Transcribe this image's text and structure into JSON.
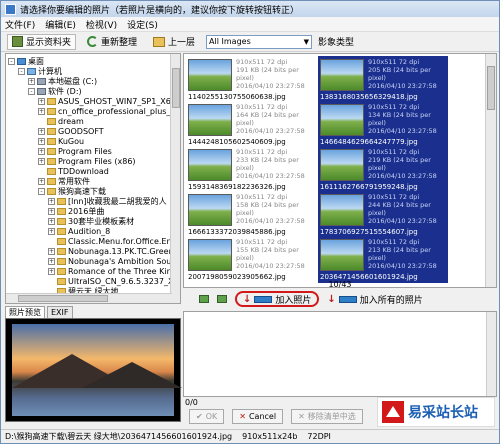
{
  "window": {
    "title": "请选择你要编辑的照片（若照片是横向的，建议你按下旋转按钮转正）"
  },
  "menu": [
    "文件(F)",
    "编辑(E)",
    "检视(V)",
    "设定(S)"
  ],
  "toolbar": {
    "show_folders": "显示资料夹",
    "reorganize": "重新整理",
    "up_one_level": "上一层",
    "filter_value": "All Images",
    "image_type": "影象类型"
  },
  "tree": [
    {
      "label": "桌面",
      "indent": 0,
      "icon": "desktop-icon",
      "expand": "-"
    },
    {
      "label": "计算机",
      "indent": 1,
      "icon": "computer-icon",
      "expand": "-"
    },
    {
      "label": "本地磁盘 (C:)",
      "indent": 2,
      "icon": "drive-icon",
      "expand": "+"
    },
    {
      "label": "软件 (D:)",
      "indent": 2,
      "icon": "drive-icon",
      "expand": "-"
    },
    {
      "label": "ASUS_GHOST_WIN7_SP1_X64_",
      "indent": 3,
      "icon": "folder-icon",
      "expand": "+"
    },
    {
      "label": "cn_office_professional_plus_2013",
      "indent": 3,
      "icon": "folder-icon",
      "expand": "+"
    },
    {
      "label": "dream",
      "indent": 3,
      "icon": "folder-icon",
      "expand": ""
    },
    {
      "label": "GOODSOFT",
      "indent": 3,
      "icon": "folder-icon",
      "expand": "+"
    },
    {
      "label": "KuGou",
      "indent": 3,
      "icon": "folder-icon",
      "expand": "+"
    },
    {
      "label": "Program Files",
      "indent": 3,
      "icon": "folder-icon",
      "expand": "+"
    },
    {
      "label": "Program Files (x86)",
      "indent": 3,
      "icon": "folder-icon",
      "expand": "+"
    },
    {
      "label": "TDDownload",
      "indent": 3,
      "icon": "folder-icon",
      "expand": ""
    },
    {
      "label": "常用软件",
      "indent": 3,
      "icon": "folder-icon",
      "expand": "+"
    },
    {
      "label": "猴狗高速下载",
      "indent": 3,
      "icon": "folder-icon",
      "expand": "-"
    },
    {
      "label": "[lnn]收藏我最二胡我爱的人",
      "indent": 4,
      "icon": "folder-icon",
      "expand": "+"
    },
    {
      "label": "2016单曲",
      "indent": 4,
      "icon": "folder-icon",
      "expand": "+"
    },
    {
      "label": "30套毕业模板素材",
      "indent": 4,
      "icon": "folder-icon",
      "expand": "+"
    },
    {
      "label": "Audition_8",
      "indent": 4,
      "icon": "folder-icon",
      "expand": "+"
    },
    {
      "label": "Classic.Menu.for.Office.Enterp",
      "indent": 4,
      "icon": "folder-icon",
      "expand": ""
    },
    {
      "label": "Nobunaga.13.PK.TC.Green.E",
      "indent": 4,
      "icon": "folder-icon",
      "expand": "+"
    },
    {
      "label": "Nobunaga's Ambition Souzou",
      "indent": 4,
      "icon": "folder-icon",
      "expand": "+"
    },
    {
      "label": "Romance of the Three Kingd",
      "indent": 4,
      "icon": "folder-icon",
      "expand": "+"
    },
    {
      "label": "UltraISO_CN_9.6.5.3237_X&",
      "indent": 4,
      "icon": "folder-icon",
      "expand": ""
    },
    {
      "label": "碧云天 绿大地",
      "indent": 4,
      "icon": "folder-icon",
      "expand": ""
    }
  ],
  "preview_tabs": [
    "照片预览",
    "EXIF"
  ],
  "thumbnails": [
    {
      "file": "1140255130755060638.jpg",
      "dims": "910x511 72 dpi",
      "size": "191 KB (24 bits per pixel)",
      "date": "2016/04/10 23:27:58",
      "selected": false
    },
    {
      "file": "1383168035656329418.jpg",
      "dims": "910x511 72 dpi",
      "size": "205 KB (24 bits per pixel)",
      "date": "2016/04/10 23:27:58",
      "selected": true
    },
    {
      "file": "1444248105602540609.jpg",
      "dims": "910x511 72 dpi",
      "size": "164 KB (24 bits per pixel)",
      "date": "2016/04/10 23:27:58",
      "selected": false
    },
    {
      "file": "1466484629664247779.jpg",
      "dims": "910x511 72 dpi",
      "size": "134 KB (24 bits per pixel)",
      "date": "2016/04/10 23:27:58",
      "selected": true
    },
    {
      "file": "1593148369182236326.jpg",
      "dims": "910x511 72 dpi",
      "size": "233 KB (24 bits per pixel)",
      "date": "2016/04/10 23:27:58",
      "selected": false
    },
    {
      "file": "1611162766791959248.jpg",
      "dims": "910x511 72 dpi",
      "size": "219 KB (24 bits per pixel)",
      "date": "2016/04/10 23:27:58",
      "selected": true
    },
    {
      "file": "1666133372039845886.jpg",
      "dims": "910x511 72 dpi",
      "size": "158 KB (24 bits per pixel)",
      "date": "2016/04/10 23:27:58",
      "selected": false
    },
    {
      "file": "1783706927515554607.jpg",
      "dims": "910x511 72 dpi",
      "size": "244 KB (24 bits per pixel)",
      "date": "2016/04/10 23:27:58",
      "selected": true
    },
    {
      "file": "2007198059023905662.jpg",
      "dims": "910x511 72 dpi",
      "size": "155 KB (24 bits per pixel)",
      "date": "2016/04/10 23:27:58",
      "selected": false
    },
    {
      "file": "2036471456601601924.jpg",
      "dims": "910x511 72 dpi",
      "size": "213 KB (24 bits per pixel)",
      "date": "2016/04/10 23:27:58",
      "selected": true
    }
  ],
  "counter": "10/43",
  "actions": {
    "add_photo": "加入照片",
    "add_all": "加入所有的照片"
  },
  "list_count": "0/0",
  "buttons": {
    "ok": "OK",
    "cancel": "Cancel",
    "remove": "移除清单中选"
  },
  "status": {
    "path": "D:\\猴狗高速下载\\碧云天 绿大地\\2036471456601601924.jpg",
    "dims": "910x511x24b",
    "dpi": "72DPI"
  },
  "watermark": {
    "brand": "易采站长站"
  }
}
